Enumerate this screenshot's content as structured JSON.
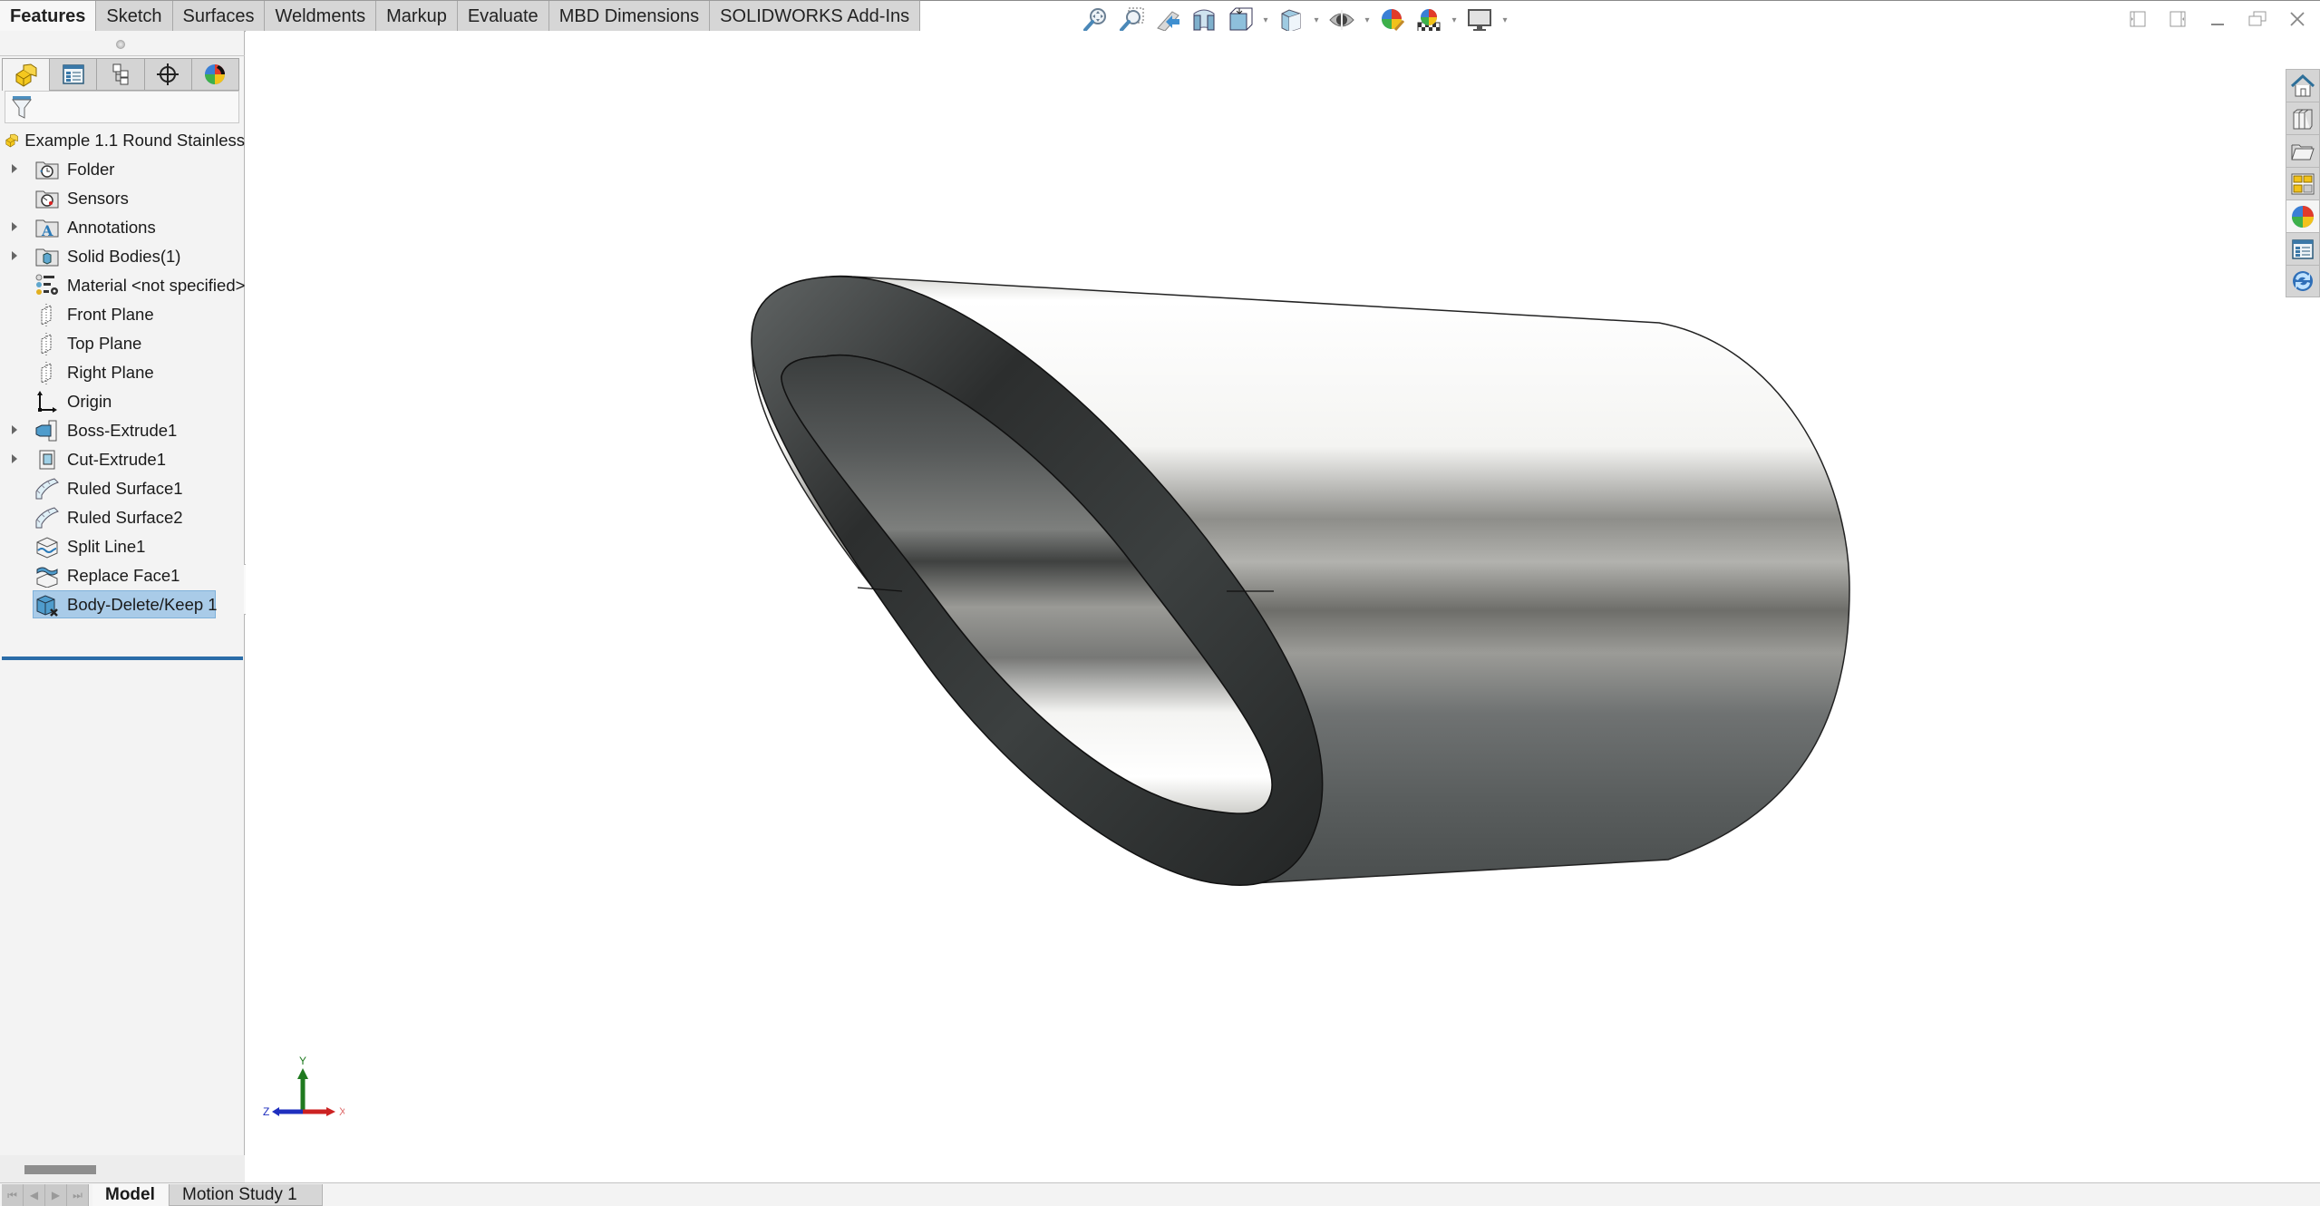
{
  "command_tabs": [
    {
      "label": "Features",
      "active": true
    },
    {
      "label": "Sketch",
      "active": false
    },
    {
      "label": "Surfaces",
      "active": false
    },
    {
      "label": "Weldments",
      "active": false
    },
    {
      "label": "Markup",
      "active": false
    },
    {
      "label": "Evaluate",
      "active": false
    },
    {
      "label": "MBD Dimensions",
      "active": false
    },
    {
      "label": "SOLIDWORKS Add-Ins",
      "active": false
    }
  ],
  "heads_up_toolbar": [
    {
      "icon": "zoom-to-fit-icon",
      "dropdown": false
    },
    {
      "icon": "zoom-to-area-icon",
      "dropdown": false
    },
    {
      "icon": "previous-view-icon",
      "dropdown": false
    },
    {
      "icon": "section-view-icon",
      "dropdown": false
    },
    {
      "icon": "view-orientation-icon",
      "dropdown": true
    },
    {
      "icon": "display-style-icon",
      "dropdown": true
    },
    {
      "icon": "hide-show-items-icon",
      "dropdown": true
    },
    {
      "icon": "edit-appearance-icon",
      "dropdown": false
    },
    {
      "icon": "apply-scene-icon",
      "dropdown": true
    },
    {
      "icon": "view-settings-icon",
      "dropdown": true
    }
  ],
  "window_controls": [
    "tile-left-icon",
    "tile-right-icon",
    "minimize-icon",
    "restore-icon",
    "close-icon"
  ],
  "manager_tabs": [
    {
      "icon": "featuremanager-icon",
      "active": true
    },
    {
      "icon": "propertymanager-icon",
      "active": false
    },
    {
      "icon": "configurationmanager-icon",
      "active": false
    },
    {
      "icon": "dimxpertmanager-icon",
      "active": false
    },
    {
      "icon": "displaymanager-icon",
      "active": false
    }
  ],
  "filter_icon": "filter-icon",
  "tree": {
    "root": "Example 1.1 Round Stainless",
    "items": [
      {
        "label": "Folder",
        "icon": "history-folder-icon",
        "expandable": true,
        "selected": false
      },
      {
        "label": "Sensors",
        "icon": "sensors-folder-icon",
        "expandable": false,
        "selected": false
      },
      {
        "label": "Annotations",
        "icon": "annotations-folder-icon",
        "expandable": true,
        "selected": false
      },
      {
        "label": "Solid Bodies(1)",
        "icon": "solid-bodies-folder-icon",
        "expandable": true,
        "selected": false
      },
      {
        "label": "Material <not specified>",
        "icon": "material-icon",
        "expandable": false,
        "selected": false
      },
      {
        "label": "Front Plane",
        "icon": "plane-icon",
        "expandable": false,
        "selected": false
      },
      {
        "label": "Top Plane",
        "icon": "plane-icon",
        "expandable": false,
        "selected": false
      },
      {
        "label": "Right Plane",
        "icon": "plane-icon",
        "expandable": false,
        "selected": false
      },
      {
        "label": "Origin",
        "icon": "origin-icon",
        "expandable": false,
        "selected": false
      },
      {
        "label": "Boss-Extrude1",
        "icon": "boss-extrude-icon",
        "expandable": true,
        "selected": false
      },
      {
        "label": "Cut-Extrude1",
        "icon": "cut-extrude-icon",
        "expandable": true,
        "selected": false
      },
      {
        "label": "Ruled Surface1",
        "icon": "ruled-surface-icon",
        "expandable": false,
        "selected": false
      },
      {
        "label": "Ruled Surface2",
        "icon": "ruled-surface-icon",
        "expandable": false,
        "selected": false
      },
      {
        "label": "Split Line1",
        "icon": "split-line-icon",
        "expandable": false,
        "selected": false
      },
      {
        "label": "Replace Face1",
        "icon": "replace-face-icon",
        "expandable": false,
        "selected": false
      },
      {
        "label": "Body-Delete/Keep 1",
        "icon": "body-delete-keep-icon",
        "expandable": false,
        "selected": true
      }
    ]
  },
  "bottom_tabs": {
    "nav": [
      "first",
      "previous",
      "next",
      "last"
    ],
    "model": "Model",
    "motion_study": "Motion Study 1"
  },
  "triad": {
    "x": "X",
    "y": "Y",
    "z": "Z",
    "colors": {
      "x": "#cc2222",
      "y": "#1f7a1f",
      "z": "#1f2fbf"
    }
  },
  "task_pane": [
    {
      "icon": "solidworks-resources-icon"
    },
    {
      "icon": "design-library-icon"
    },
    {
      "icon": "file-explorer-icon"
    },
    {
      "icon": "view-palette-icon"
    },
    {
      "icon": "appearances-scenes-icon"
    },
    {
      "icon": "custom-properties-icon"
    },
    {
      "icon": "solidworks-forum-icon"
    }
  ],
  "colors": {
    "selection": "#a9cbe8",
    "rollback_bar": "#2a6ca8",
    "panel_bg": "#f3f3f3"
  }
}
